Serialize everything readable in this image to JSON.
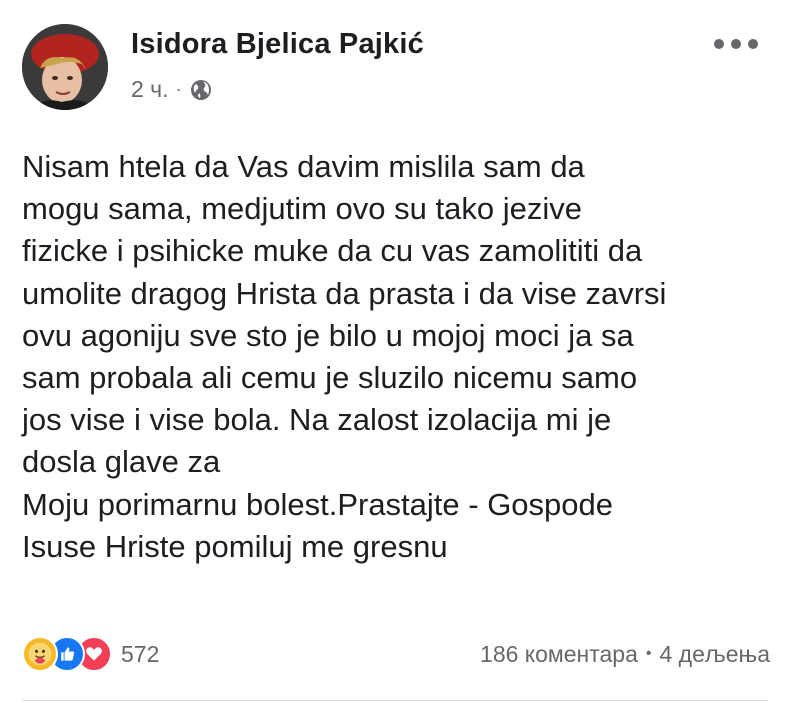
{
  "post": {
    "author": "Isidora Bjelica Pajkić",
    "time": "2 ч.",
    "separator": "·",
    "lines": [
      "Nisam htela da Vas davim mislila sam da",
      "mogu sama, medjutim ovo su tako jezive",
      "fizicke i psihicke muke da cu vas zamolititi da",
      "umolite dragog Hrista da prasta i da vise zavrsi",
      "ovu agoniju sve sto je bilo u mojoj moci ja sa",
      "sam probala ali cemu je sluzilo nicemu samo",
      "jos vise i vise bola. Na zalost izolacija mi je",
      "dosla glave za",
      "Moju porimarnu bolest.Prastajte - Gospode",
      "Isuse Hriste pomiluj me gresnu"
    ]
  },
  "footer": {
    "reaction_count": "572",
    "comments": "186 коментара",
    "separator": "•",
    "shares": "4 дељења"
  },
  "icons": {
    "audience": "globe-icon",
    "more": "more-options-icon",
    "reactions": [
      "care-reaction-icon",
      "like-reaction-icon",
      "love-reaction-icon"
    ]
  },
  "colors": {
    "text": "#1c1e21",
    "secondary": "#65676b",
    "like": "#1877f2",
    "love": "#f33e58",
    "care": "#f7b928"
  }
}
